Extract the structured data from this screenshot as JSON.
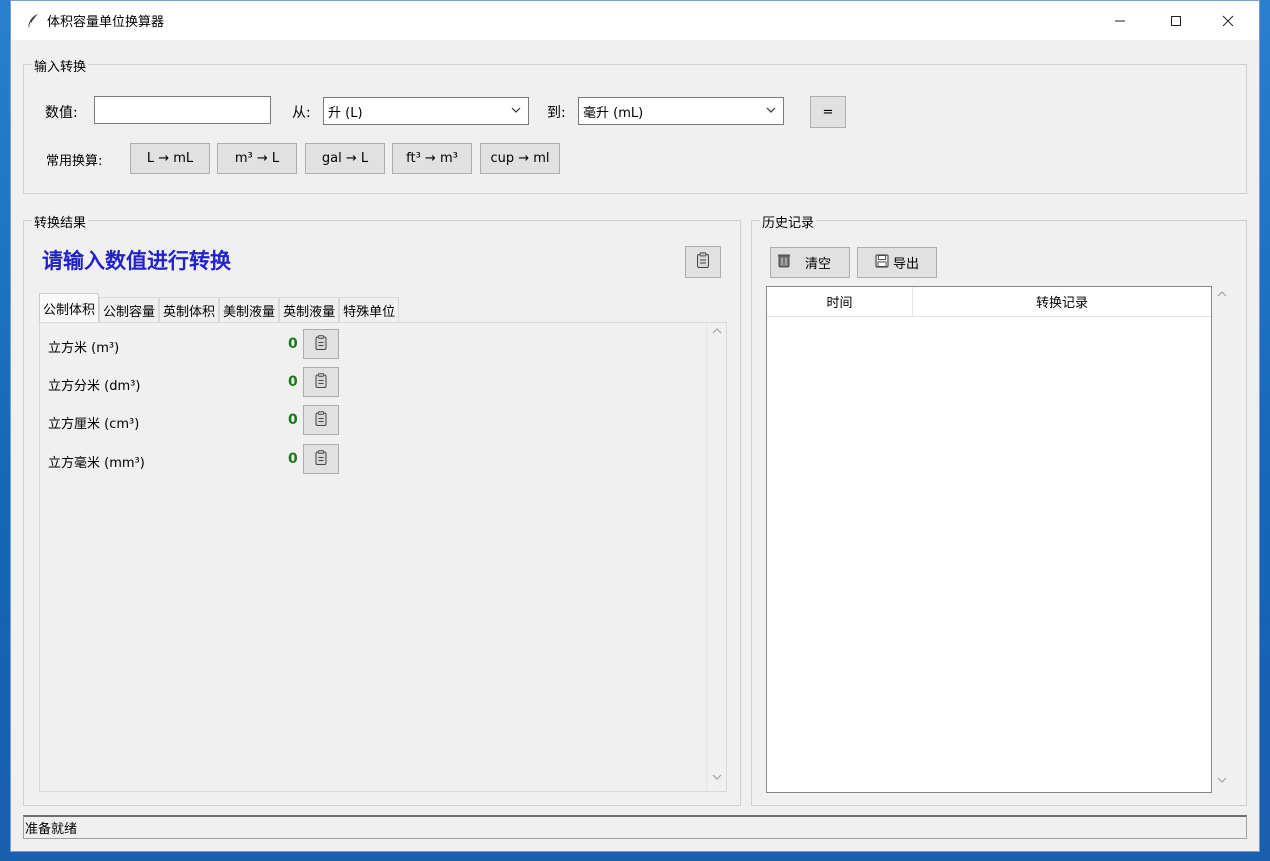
{
  "window": {
    "title": "体积容量单位换算器",
    "controls": {
      "minimize": "—",
      "maximize": "☐",
      "close": "✕"
    }
  },
  "input_group": {
    "label": "输入转换",
    "value_label": "数值:",
    "value": "",
    "from_label": "从:",
    "from_value": "升 (L)",
    "to_label": "到:",
    "to_value": "毫升 (mL)",
    "equals_button": "=",
    "common_label": "常用换算:",
    "quick_buttons": [
      "L → mL",
      "m³ → L",
      "gal → L",
      "ft³ → m³",
      "cup → ml"
    ]
  },
  "result_group": {
    "label": "转换结果",
    "prompt": "请输入数值进行转换",
    "tabs": [
      "公制体积",
      "公制容量",
      "英制体积",
      "美制液量",
      "英制液量",
      "特殊单位"
    ],
    "active_tab": 0,
    "rows": [
      {
        "name": "立方米 (m³)",
        "value": "0"
      },
      {
        "name": "立方分米 (dm³)",
        "value": "0"
      },
      {
        "name": "立方厘米 (cm³)",
        "value": "0"
      },
      {
        "name": "立方毫米 (mm³)",
        "value": "0"
      }
    ]
  },
  "history_group": {
    "label": "历史记录",
    "clear_button": "清空",
    "export_button": "导出",
    "columns": [
      "时间",
      "转换记录"
    ]
  },
  "status_bar": {
    "text": "准备就绪"
  },
  "colors": {
    "prompt": "#2222cc",
    "value": "#1a7a1a"
  }
}
